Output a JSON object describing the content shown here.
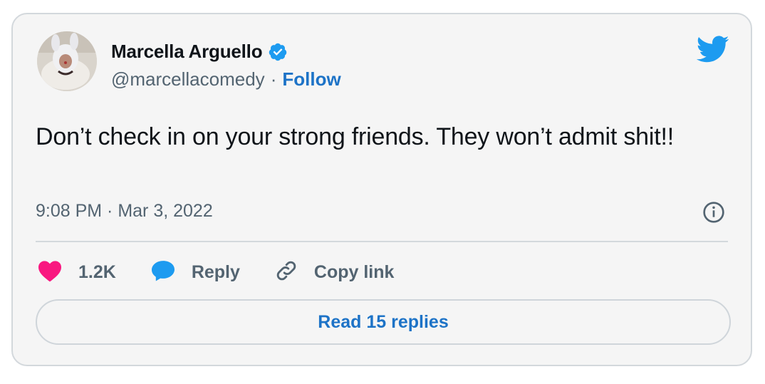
{
  "tweet": {
    "author": {
      "name": "Marcella Arguello",
      "handle": "@marcellacomedy",
      "separator": "·",
      "follow_label": "Follow",
      "verified": true,
      "avatar_icon": "profile-photo"
    },
    "text": "Don’t check in on your strong friends. They won’t admit shit!!",
    "timestamp": "9:08 PM · Mar 3, 2022",
    "actions": {
      "like_count": "1.2K",
      "reply_label": "Reply",
      "copy_link_label": "Copy link"
    },
    "read_replies_label": "Read 15 replies"
  },
  "icons": {
    "brand": "twitter-bird-icon",
    "verified": "verified-badge-icon",
    "info": "info-icon",
    "like": "heart-icon",
    "reply": "speech-bubble-icon",
    "copy": "link-icon"
  },
  "colors": {
    "brand_blue": "#1d9bf0",
    "link_blue": "#1d73c7",
    "like_pink": "#f91880",
    "muted": "#536471",
    "text": "#0f1419",
    "border": "#d3d8dc",
    "background": "#f5f5f5"
  }
}
